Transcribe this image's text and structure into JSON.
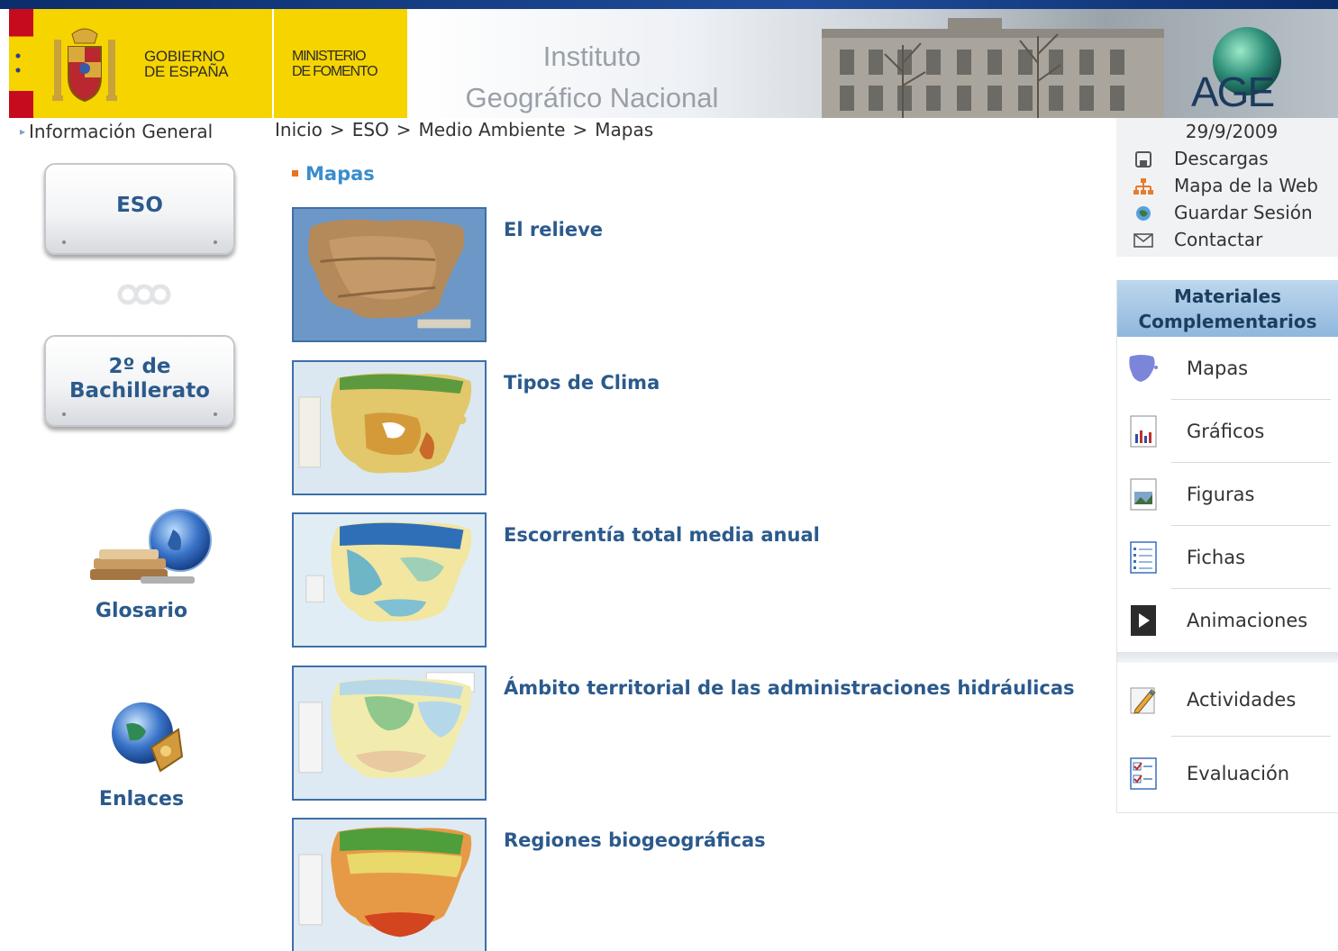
{
  "header": {
    "gobierno_line1": "GOBIERNO",
    "gobierno_line2": "DE ESPAÑA",
    "ministerio_line1": "MINISTERIO",
    "ministerio_line2": "DE FOMENTO",
    "instituto_line1": "Instituto",
    "instituto_line2": "Geográfico Nacional",
    "age_logo": "AGE"
  },
  "left_nav": {
    "info_general": "Información General",
    "eso_button": "ESO",
    "bach_button_line1": "2º de",
    "bach_button_line2": "Bachillerato",
    "glosario": "Glosario",
    "enlaces": "Enlaces"
  },
  "breadcrumb": [
    "Inicio",
    "ESO",
    "Medio Ambiente",
    "Mapas"
  ],
  "breadcrumb_separator": ">",
  "main": {
    "section_title": "Mapas",
    "items": [
      {
        "title": "El relieve",
        "thumb": "relief-map"
      },
      {
        "title": "Tipos de Clima",
        "thumb": "climate-map"
      },
      {
        "title": "Escorrentía total media anual",
        "thumb": "runoff-map"
      },
      {
        "title": "Ámbito territorial de las administraciones hidráulicas",
        "thumb": "hydro-admin-map"
      },
      {
        "title": "Regiones biogeográficas",
        "thumb": "biogeo-map"
      }
    ]
  },
  "right_panel": {
    "date": "29/9/2009",
    "utility": [
      {
        "label": "Descargas",
        "icon": "save-icon"
      },
      {
        "label": "Mapa de la Web",
        "icon": "sitemap-icon"
      },
      {
        "label": "Guardar Sesión",
        "icon": "globe-icon"
      },
      {
        "label": "Contactar",
        "icon": "envelope-icon"
      }
    ],
    "materials_title_line1": "Materiales",
    "materials_title_line2": "Complementarios",
    "materials": [
      {
        "label": "Mapas",
        "icon": "spain-map-icon"
      },
      {
        "label": "Gráficos",
        "icon": "bar-chart-icon"
      },
      {
        "label": "Figuras",
        "icon": "picture-icon"
      },
      {
        "label": "Fichas",
        "icon": "list-sheet-icon"
      },
      {
        "label": "Animaciones",
        "icon": "play-icon"
      }
    ],
    "materials2": [
      {
        "label": "Actividades",
        "icon": "pencil-icon"
      },
      {
        "label": "Evaluación",
        "icon": "checklist-icon"
      }
    ]
  },
  "colors": {
    "link_blue": "#2b5a8c",
    "section_blue": "#3a8dcc",
    "accent_orange": "#e8721c",
    "gov_yellow": "#f6d400"
  }
}
